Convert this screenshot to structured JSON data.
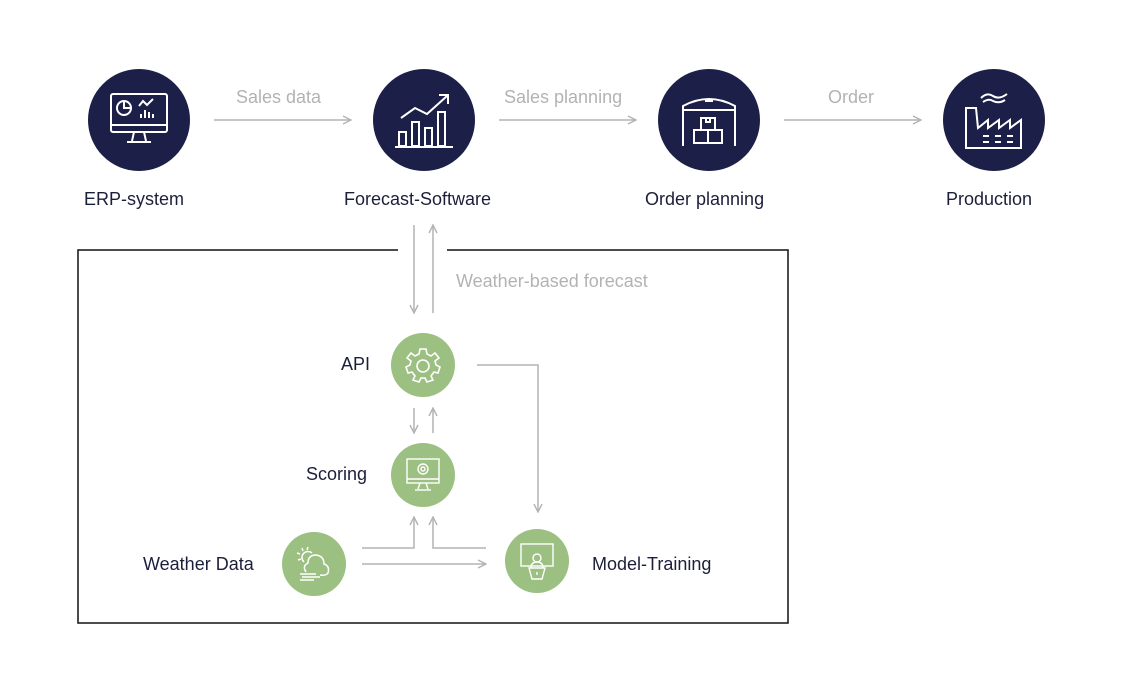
{
  "top_flow": {
    "nodes": [
      {
        "label": "ERP-system",
        "icon": "monitor-dashboard-icon"
      },
      {
        "label": "Forecast-Software",
        "icon": "bar-chart-trend-icon"
      },
      {
        "label": "Order planning",
        "icon": "warehouse-boxes-icon"
      },
      {
        "label": "Production",
        "icon": "factory-icon"
      }
    ],
    "edges": [
      {
        "label": "Sales data"
      },
      {
        "label": "Sales planning"
      },
      {
        "label": "Order"
      }
    ]
  },
  "subsystem": {
    "feedback_label": "Weather-based forecast",
    "nodes": [
      {
        "label": "API",
        "icon": "gear-icon"
      },
      {
        "label": "Scoring",
        "icon": "monitor-gear-icon"
      },
      {
        "label": "Weather Data",
        "icon": "sun-cloud-wind-icon"
      },
      {
        "label": "Model-Training",
        "icon": "presentation-trainer-icon"
      }
    ]
  },
  "colors": {
    "primary_node": "#1c1f47",
    "secondary_node": "#9cbf82",
    "arrow": "#b3b3b3",
    "box_border": "#111111"
  }
}
